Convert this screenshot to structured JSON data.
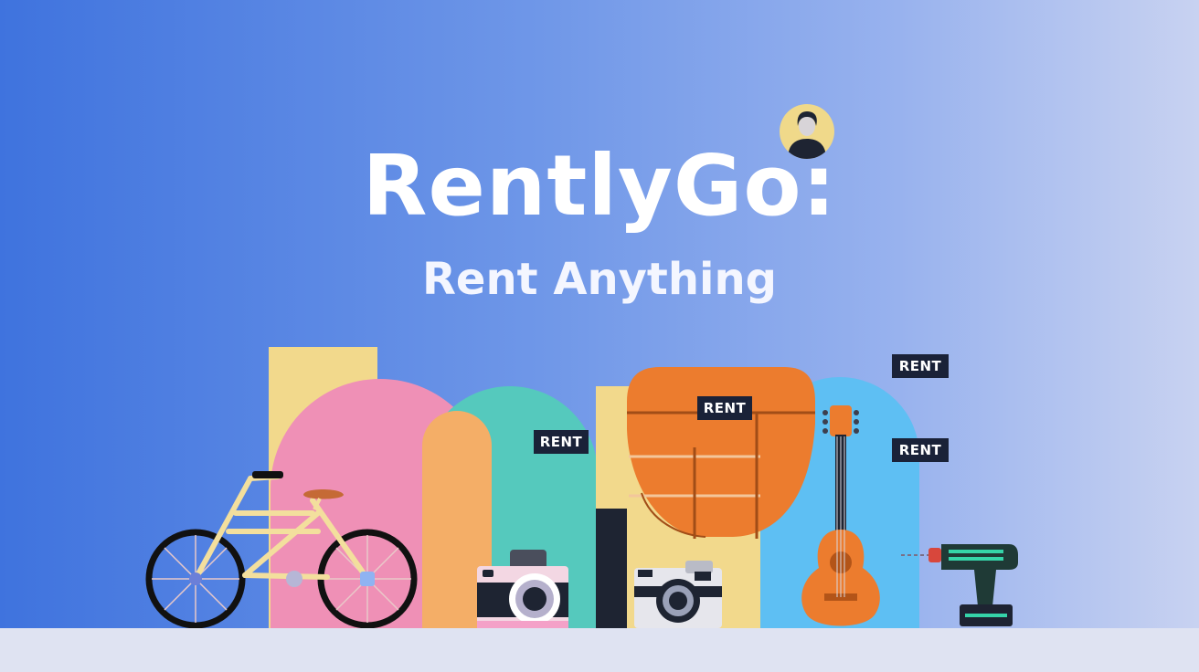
{
  "hero": {
    "title": "RentlyGo:",
    "subtitle": "Rent Anything"
  },
  "tags": {
    "teal": "RENT",
    "orange": "RENT",
    "blue_top": "RENT",
    "blue_mid": "RENT"
  },
  "icons": {
    "avatar": "user-avatar",
    "bicycle": "bicycle-icon",
    "camera_pink": "camera-icon",
    "camera_gray": "camera-icon",
    "guitar": "guitar-icon",
    "drill": "drill-icon",
    "chair": "chair-icon"
  },
  "colors": {
    "bg_start": "#3f73de",
    "bg_end": "#c8d2f1",
    "yellow": "#f2d98c",
    "pink": "#ef90b6",
    "peach": "#f4ae67",
    "teal": "#55c9bd",
    "orange": "#ec7c2e",
    "sky": "#5ebff3",
    "tag": "#1a2238"
  }
}
